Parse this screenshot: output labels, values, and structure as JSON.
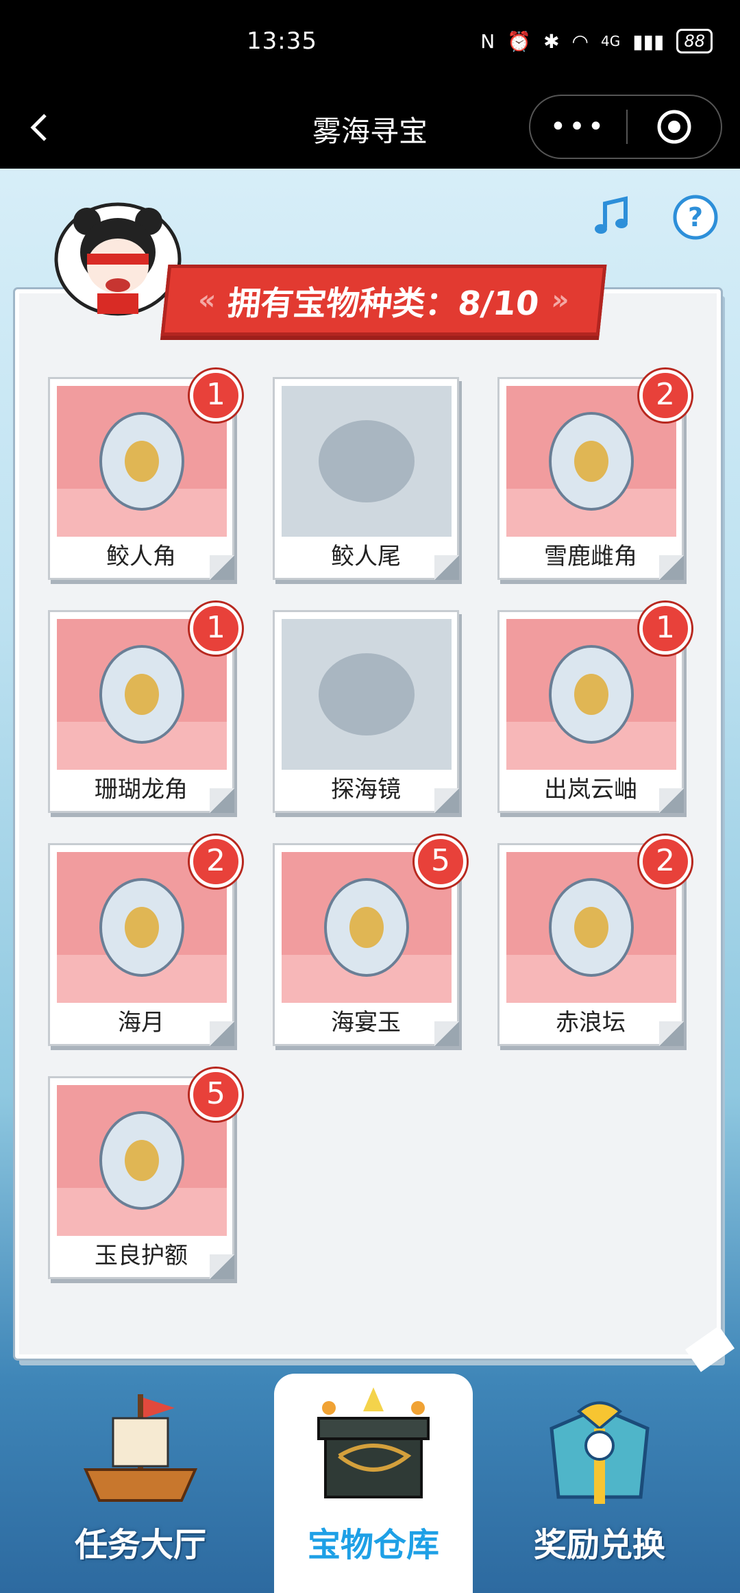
{
  "status": {
    "time": "13:35",
    "network": "4G",
    "battery": "88"
  },
  "nav": {
    "title": "雾海寻宝",
    "more_label": "•••"
  },
  "panel": {
    "title": "拥有宝物种类：8/10"
  },
  "colors": {
    "card_bg": "#f19c9e",
    "badge": "#e8413a",
    "accent": "#1ea0e6",
    "banner": "#e23a31"
  },
  "treasures": [
    {
      "name": "鲛人角",
      "count": "1",
      "owned": true,
      "icon": "horn-icon"
    },
    {
      "name": "鲛人尾",
      "count": "",
      "owned": false,
      "icon": "tail-icon"
    },
    {
      "name": "雪鹿雌角",
      "count": "2",
      "owned": true,
      "icon": "antler-icon"
    },
    {
      "name": "珊瑚龙角",
      "count": "1",
      "owned": true,
      "icon": "coral-horn-icon"
    },
    {
      "name": "探海镜",
      "count": "",
      "owned": false,
      "icon": "telescope-icon"
    },
    {
      "name": "出岚云岫",
      "count": "1",
      "owned": true,
      "icon": "ornament-icon"
    },
    {
      "name": "海月",
      "count": "2",
      "owned": true,
      "icon": "jellyfish-icon"
    },
    {
      "name": "海宴玉",
      "count": "5",
      "owned": true,
      "icon": "flower-jade-icon"
    },
    {
      "name": "赤浪坛",
      "count": "2",
      "owned": true,
      "icon": "jar-icon"
    },
    {
      "name": "玉良护额",
      "count": "5",
      "owned": true,
      "icon": "headband-icon"
    }
  ],
  "tabs": [
    {
      "label": "任务大厅",
      "icon": "ship-icon"
    },
    {
      "label": "宝物仓库",
      "icon": "chest-icon"
    },
    {
      "label": "奖励兑换",
      "icon": "gift-icon"
    }
  ]
}
